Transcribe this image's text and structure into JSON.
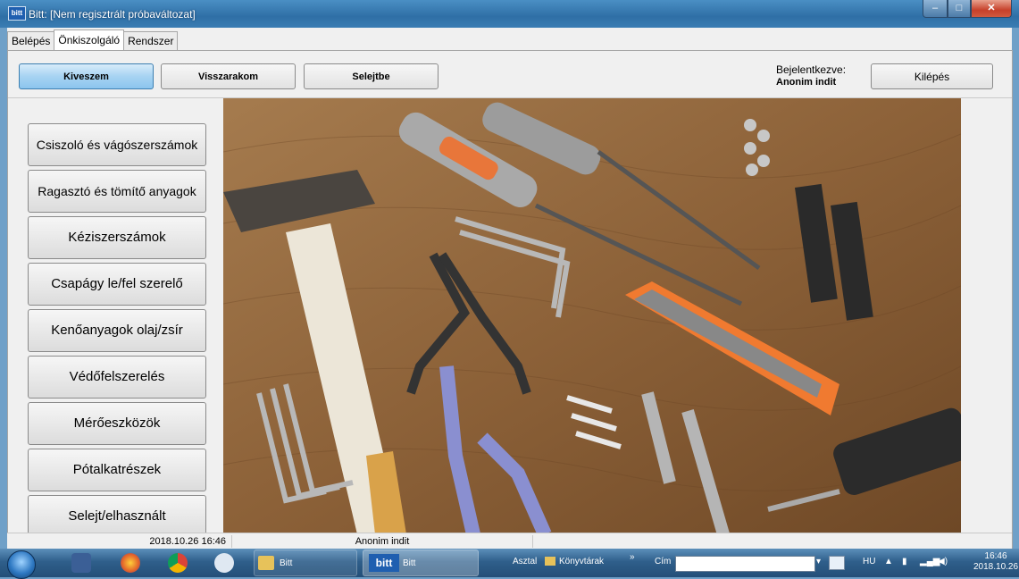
{
  "window": {
    "title": "Bitt: [Nem regisztrált próbaváltozat]",
    "app_icon": "bitt"
  },
  "tabs": [
    {
      "label": "Belépés",
      "active": false
    },
    {
      "label": "Önkiszolgáló",
      "active": true
    },
    {
      "label": "Rendszer",
      "active": false
    }
  ],
  "toolbar": {
    "btn1": "Kiveszem",
    "btn2": "Visszarakom",
    "btn3": "Selejtbe",
    "logged_in_label": "Bejelentkezve:",
    "user": "Anonim indit",
    "logout": "Kilépés"
  },
  "categories": [
    "Csiszoló és vágószerszámok",
    "Ragasztó és tömítő anyagok",
    "Kéziszerszámok",
    "Csapágy le/fel szerelő",
    "Kenőanyagok olaj/zsír",
    "Védőfelszerelés",
    "Mérőeszközök",
    "Pótalkatrészek",
    "Selejt/elhasznált"
  ],
  "status": {
    "datetime": "2018.10.26 16:46",
    "user": "Anonim indit"
  },
  "taskbar": {
    "bitt_folder": "Bitt",
    "bitt_app": "Bitt",
    "bitt_logo": "bitt",
    "asztal": "Asztal",
    "konyvtarak": "Könyvtárak",
    "chevron": "»",
    "cim": "Cím",
    "lang": "HU",
    "time": "16:46",
    "date": "2018.10.26"
  },
  "colors": {
    "primary_button": "#9dcdf0",
    "title_bar": "#3a7db3"
  }
}
